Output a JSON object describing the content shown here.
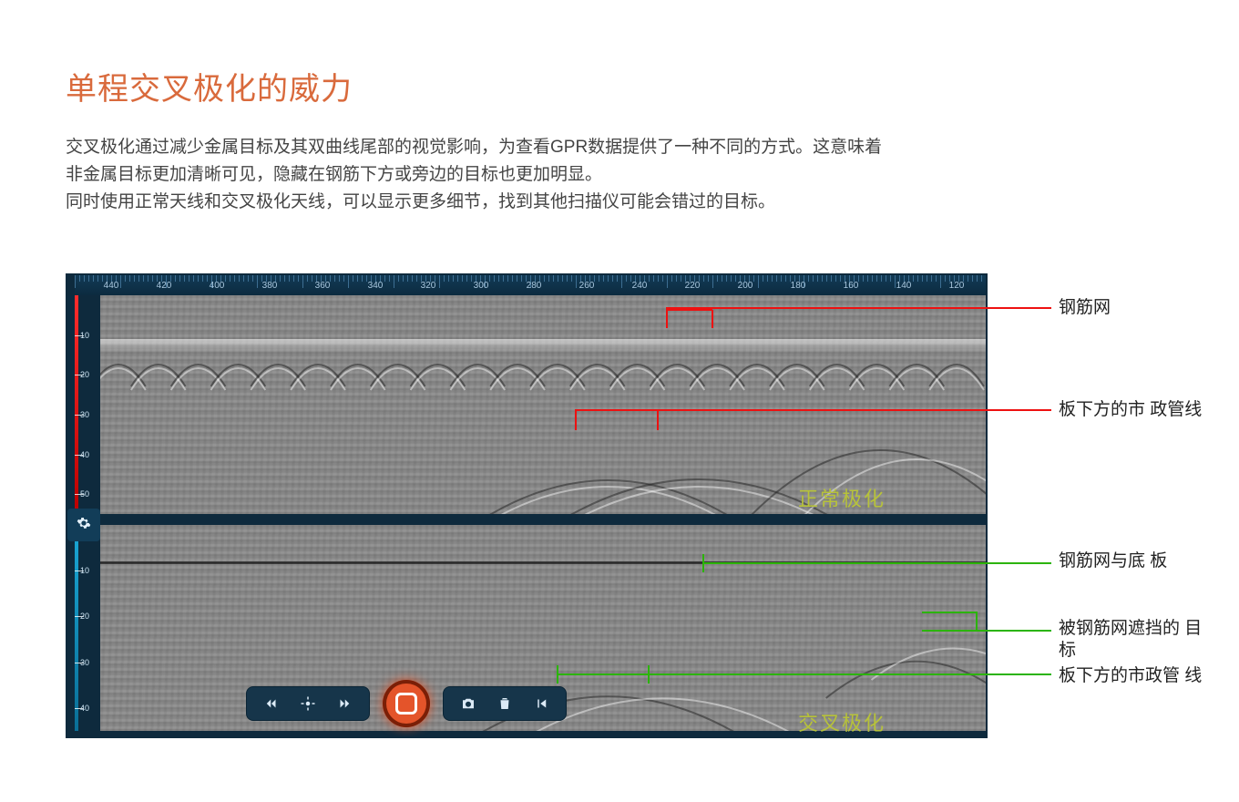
{
  "heading": "单程交叉极化的威力",
  "paragraph": "交叉极化通过减少金属目标及其双曲线尾部的视觉影响，为查看GPR数据提供了一种不同的方式。这意味着\n非金属目标更加清晰可见，隐藏在钢筋下方或旁边的目标也更加明显。\n同时使用正常天线和交叉极化天线，可以显示更多细节，找到其他扫描仪可能会错过的目标。",
  "scan": {
    "ruler_ticks": [
      "440",
      "420",
      "400",
      "380",
      "360",
      "340",
      "320",
      "300",
      "280",
      "260",
      "240",
      "220",
      "200",
      "180",
      "160",
      "140",
      "120"
    ],
    "depth_top": [
      "10",
      "20",
      "30",
      "40",
      "50"
    ],
    "depth_bot": [
      "10",
      "20",
      "30",
      "40"
    ],
    "caption_top": "正常极化",
    "caption_bot": "交叉极化"
  },
  "callouts": {
    "rebar_mesh": "钢筋网",
    "utility_below_slab_1": "板下方的市\n政管线",
    "mesh_and_bottom": "钢筋网与底\n板",
    "obscured_target": "被钢筋网遮挡的\n目标",
    "utility_below_slab_2": "板下方的市政管\n线"
  },
  "icons": {
    "gear": "settings",
    "prev_fast": "double-chevron-left",
    "center": "crosshair",
    "next_fast": "double-chevron-right",
    "camera": "camera",
    "delete": "trash",
    "rewind": "skip-back",
    "record": "stop-record"
  }
}
